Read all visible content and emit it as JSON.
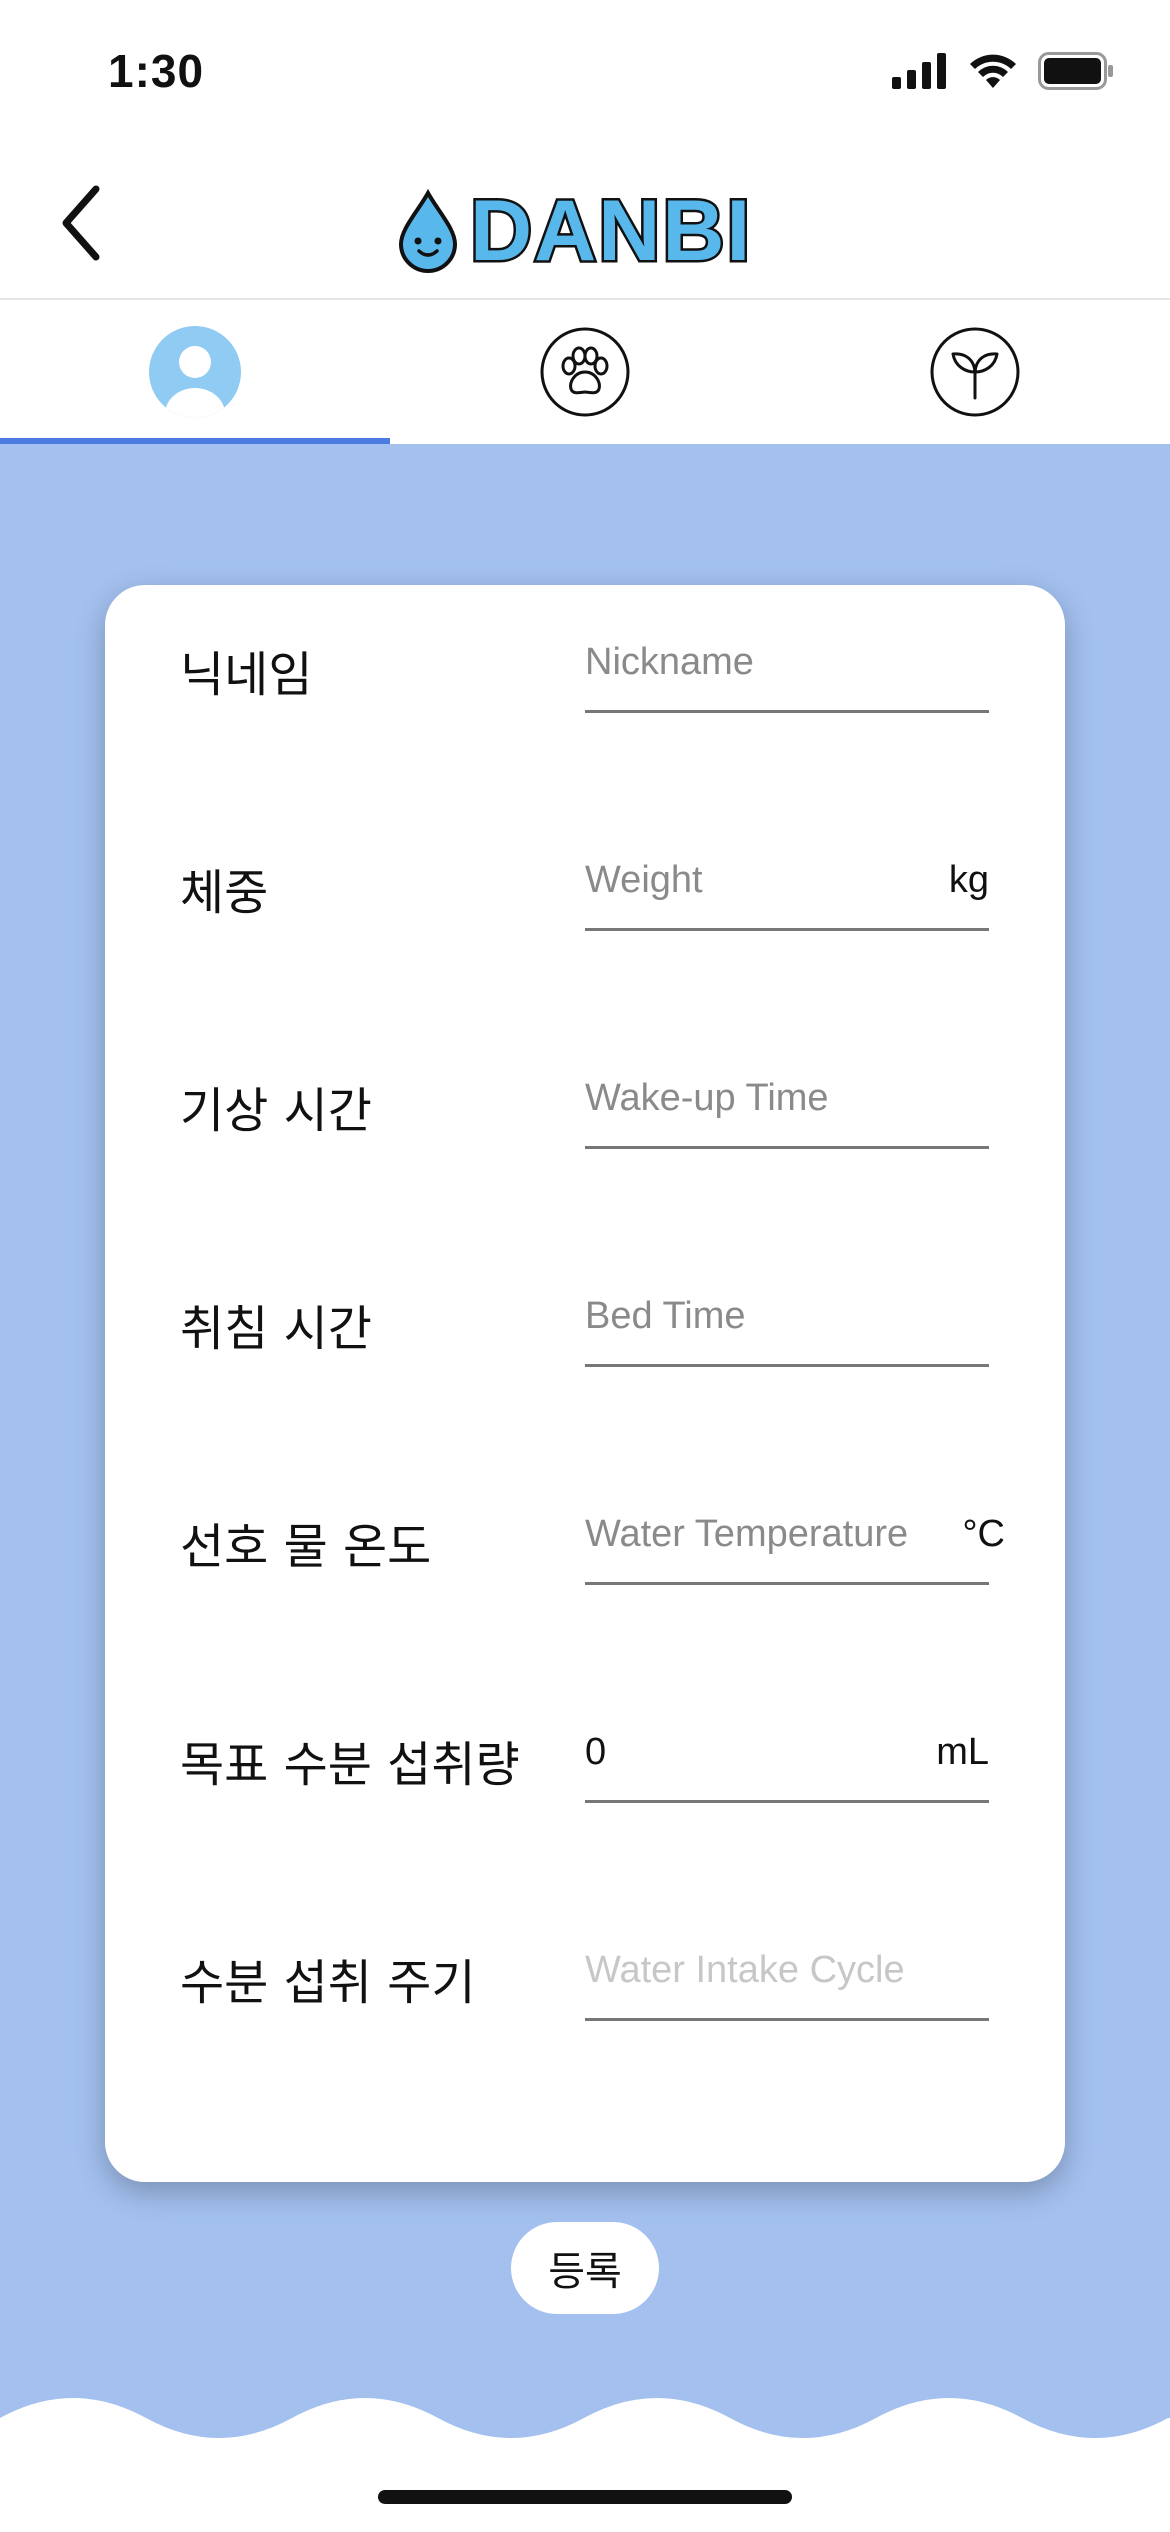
{
  "status_bar": {
    "time": "1:30"
  },
  "header": {
    "logo_text": "DANBI"
  },
  "tabs": [
    {
      "icon": "person-icon",
      "active": true
    },
    {
      "icon": "paw-icon",
      "active": false
    },
    {
      "icon": "sprout-icon",
      "active": false
    }
  ],
  "form": {
    "nickname": {
      "label": "닉네임",
      "placeholder": "Nickname"
    },
    "weight": {
      "label": "체중",
      "placeholder": "Weight",
      "unit": "kg"
    },
    "wake_time": {
      "label": "기상 시간",
      "placeholder": "Wake-up Time"
    },
    "bed_time": {
      "label": "취침 시간",
      "placeholder": "Bed Time"
    },
    "water_temp": {
      "label": "선호 물 온도",
      "placeholder": "Water Temperature",
      "unit": "°C"
    },
    "goal_intake": {
      "label": "목표 수분 섭취량",
      "value": "0",
      "unit": "mL"
    },
    "intake_cycle": {
      "label": "수분 섭취 주기",
      "placeholder": "Water Intake Cycle"
    }
  },
  "register_button": {
    "label": "등록"
  },
  "colors": {
    "background_blue": "#a3c0ef",
    "tab_indicator": "#4a7be0",
    "logo_blue": "#58b8ec",
    "avatar_blue": "#8fcbf2"
  }
}
